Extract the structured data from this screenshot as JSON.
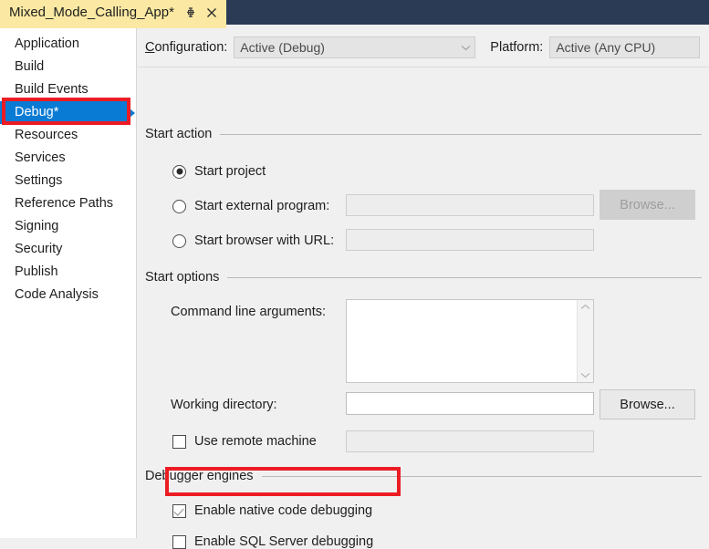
{
  "tab": {
    "title": "Mixed_Mode_Calling_App*",
    "pin_icon": "pin-icon",
    "close_icon": "close-icon"
  },
  "sidebar": {
    "items": [
      {
        "label": "Application",
        "selected": false
      },
      {
        "label": "Build",
        "selected": false
      },
      {
        "label": "Build Events",
        "selected": false
      },
      {
        "label": "Debug*",
        "selected": true
      },
      {
        "label": "Resources",
        "selected": false
      },
      {
        "label": "Services",
        "selected": false
      },
      {
        "label": "Settings",
        "selected": false
      },
      {
        "label": "Reference Paths",
        "selected": false
      },
      {
        "label": "Signing",
        "selected": false
      },
      {
        "label": "Security",
        "selected": false
      },
      {
        "label": "Publish",
        "selected": false
      },
      {
        "label": "Code Analysis",
        "selected": false
      }
    ]
  },
  "toolbar": {
    "configuration_label": "Configuration:",
    "configuration_value": "Active (Debug)",
    "configuration_chevron": "chevron-down-icon",
    "platform_label": "Platform:",
    "platform_value": "Active (Any CPU)"
  },
  "start_action": {
    "header": "Start action",
    "radios": [
      {
        "label": "Start project",
        "checked": true
      },
      {
        "label": "Start external program:",
        "checked": false
      },
      {
        "label": "Start browser with URL:",
        "checked": false
      }
    ],
    "external_program_value": "",
    "browser_url_value": "",
    "browse_label": "Browse...",
    "browse_enabled": false
  },
  "start_options": {
    "header": "Start options",
    "command_line_label": "Command line arguments:",
    "command_line_value": "",
    "scroll_up_icon": "chevron-up-icon",
    "scroll_down_icon": "chevron-down-icon",
    "working_directory_label": "Working directory:",
    "working_directory_value": "",
    "browse_label": "Browse...",
    "browse_enabled": true,
    "remote_machine_label": "Use remote machine",
    "remote_machine_checked": false,
    "remote_machine_value": ""
  },
  "debugger_engines": {
    "header": "Debugger engines",
    "checkboxes": [
      {
        "label": "Enable native code debugging",
        "checked": true
      },
      {
        "label": "Enable SQL Server debugging",
        "checked": false
      }
    ]
  },
  "annotations": {
    "highlight_color": "#ec1c24",
    "selection_color": "#0a7bd4",
    "tab_color": "#fbe9a3",
    "titlebar_color": "#2b3a55"
  }
}
